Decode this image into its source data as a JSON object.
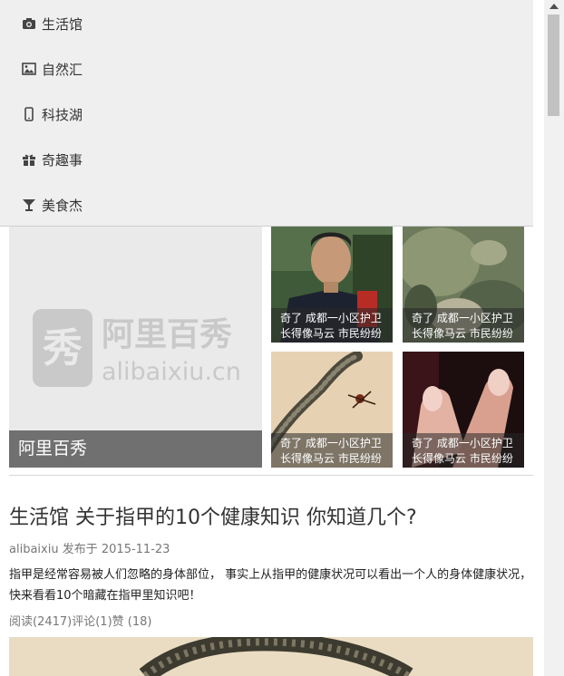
{
  "menu": {
    "items": [
      {
        "label": "生活馆",
        "icon": "camera-icon"
      },
      {
        "label": "自然汇",
        "icon": "image-icon"
      },
      {
        "label": "科技湖",
        "icon": "mobile-icon"
      },
      {
        "label": "奇趣事",
        "icon": "gift-icon"
      },
      {
        "label": "美食杰",
        "icon": "cocktail-icon"
      }
    ]
  },
  "slider": {
    "hero_caption": "阿里百秀",
    "logo_cn": "阿里百秀",
    "logo_en": "alibaixiu.cn",
    "logo_mark": "秀",
    "thumbs": [
      {
        "line1": "奇了 成都一小区护卫",
        "line2": "长得像马云 市民纷纷"
      },
      {
        "line1": "奇了 成都一小区护卫",
        "line2": "长得像马云 市民纷纷"
      },
      {
        "line1": "奇了 成都一小区护卫",
        "line2": "长得像马云 市民纷纷"
      },
      {
        "line1": "奇了 成都一小区护卫",
        "line2": "长得像马云 市民纷纷"
      }
    ]
  },
  "article": {
    "title": "生活馆 关于指甲的10个健康知识 你知道几个?",
    "author": "alibaixiu",
    "published_label": "发布于",
    "date": "2015-11-23",
    "excerpt": "指甲是经常容易被人们忽略的身体部位， 事实上从指甲的健康状况可以看出一个人的身体健康状况， 快来看看10个暗藏在指甲里知识吧！",
    "reads": "阅读(2417)",
    "comments": "评论(1)",
    "likes": "赞 (18)"
  },
  "colors": {
    "menu_bg": "#efefef",
    "caption_bg": "#5a5a5a"
  }
}
